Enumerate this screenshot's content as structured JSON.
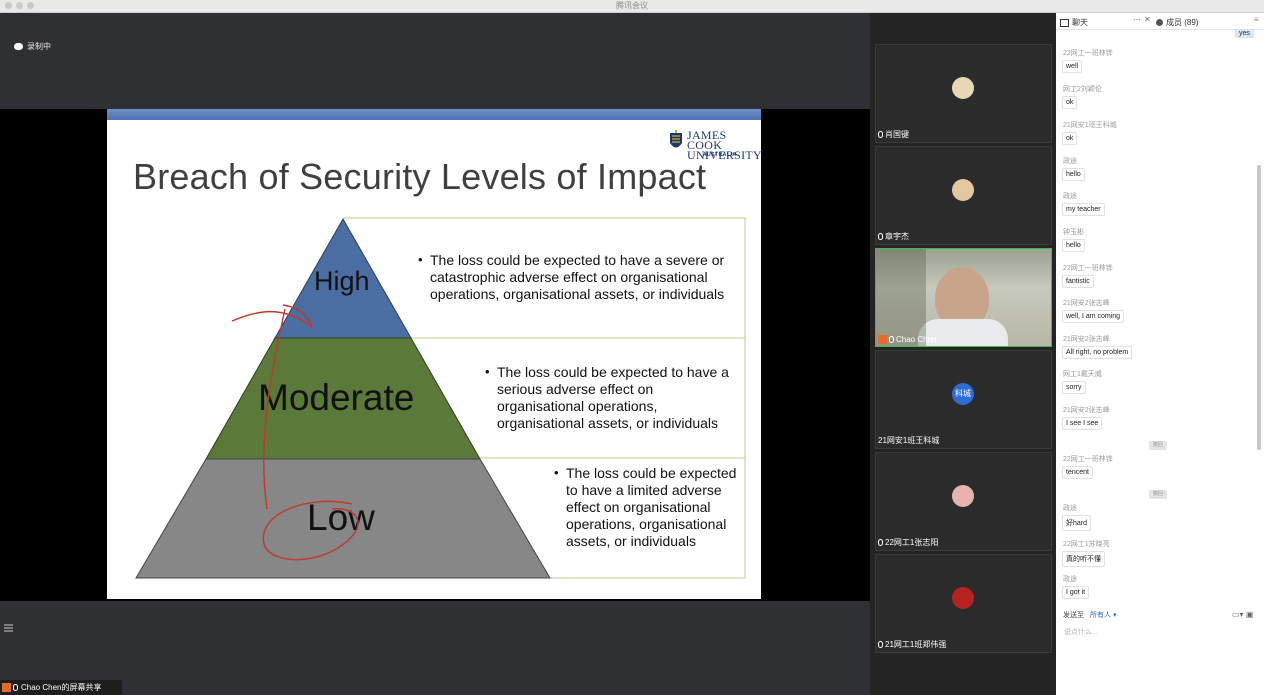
{
  "window": {
    "title": "腾讯会议"
  },
  "recording": {
    "label": "录制中"
  },
  "screen_share": {
    "owner_label": "Chao Chen的屏幕共享",
    "slide": {
      "title": "Breach of Security Levels of Impact",
      "logo": {
        "line1": "JAMES COOK",
        "line2": "UNIVERSITY",
        "country": "AUSTRALIA"
      },
      "levels": [
        {
          "label": "High",
          "color": "#4a6ea2",
          "description": [
            "The loss could be expected to have a severe or",
            "catastrophic adverse effect on organisational",
            "operations, organisational assets, or individuals"
          ]
        },
        {
          "label": "Moderate",
          "color": "#5b7a3a",
          "description": [
            "The loss could be expected to have a",
            "serious adverse effect on",
            "organisational operations,",
            "organisational assets, or individuals"
          ]
        },
        {
          "label": "Low",
          "color": "#878787",
          "description": [
            "The loss could be expected",
            "to have a limited adverse",
            "effect on organisational",
            "operations, organisational",
            "assets, or individuals"
          ]
        }
      ]
    }
  },
  "participants": [
    {
      "name": "肖国键",
      "avatar_color": "#e8d7b5"
    },
    {
      "name": "章宇杰",
      "avatar_color": "#e2c7a1"
    },
    {
      "name": "Chao Chen",
      "avatar_color": "#c8a58a"
    },
    {
      "name": "21网安1班王科城",
      "avatar_text": "科城",
      "avatar_color": "#2f6bd4"
    },
    {
      "name": "22网工1张志阳",
      "avatar_color": "#e7b3b0"
    },
    {
      "name": "21网工1班郑伟强",
      "avatar_color": "#b52220"
    }
  ],
  "chat": {
    "tab_chat": "聊天",
    "tab_members": "成员 (89)",
    "yes_message": "yes",
    "messages": [
      {
        "sender": "22网工一班林铧",
        "text": "well"
      },
      {
        "sender": "网工2刘颖伦",
        "text": "ok"
      },
      {
        "sender": "21网安1班王科城",
        "text": "ok"
      },
      {
        "sender": "政途",
        "text": "hello"
      },
      {
        "sender": "政途",
        "text": "my teacher"
      },
      {
        "sender": "钟玉彬",
        "text": "hello"
      },
      {
        "sender": "22网工一班林铧",
        "text": "fantistic"
      },
      {
        "sender": "21网安2张志峰",
        "text": "well, I am coming"
      },
      {
        "sender": "21网安2张志峰",
        "text": "All right, no problem"
      },
      {
        "sender": "网工1戴天威",
        "text": "sorry"
      },
      {
        "sender": "21网安2张志峰",
        "text": "I see I see"
      },
      {
        "sender": "22网工一班林铧",
        "text": "tencent"
      },
      {
        "sender": "政途",
        "text": "好hard"
      },
      {
        "sender": "22网工1苏晓亮",
        "text": "真的听不懂"
      },
      {
        "sender": "政途",
        "text": "I got it"
      }
    ],
    "pill_label": "撤回",
    "send_to_label": "发送至",
    "send_target": "所有人 ▾",
    "input_placeholder": "说点什么..."
  }
}
